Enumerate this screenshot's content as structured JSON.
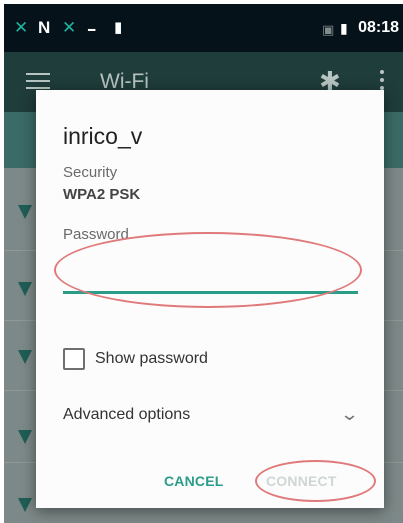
{
  "status_bar": {
    "icons": [
      "app-icon-x",
      "signal-n-icon",
      "app-icon-x",
      "dash-icon",
      "usb-icon",
      "no-sim-icon",
      "battery-icon"
    ],
    "time": "08:18"
  },
  "app_bar": {
    "title": "Wi-Fi",
    "icons": [
      "menu-icon",
      "gear-icon",
      "overflow-icon"
    ]
  },
  "dialog": {
    "network_name": "inrico_v",
    "security_label": "Security",
    "security_value": "WPA2 PSK",
    "password_label": "Password",
    "password_value": "",
    "show_password_label": "Show password",
    "show_password_checked": false,
    "advanced_options_label": "Advanced options",
    "cancel_label": "CANCEL",
    "connect_label": "CONNECT",
    "connect_enabled": false
  },
  "colors": {
    "accent": "#2a9d89",
    "annotation_oval": "#e07a7a",
    "app_bar": "#1f3d3b",
    "status_bar": "#06121a"
  }
}
